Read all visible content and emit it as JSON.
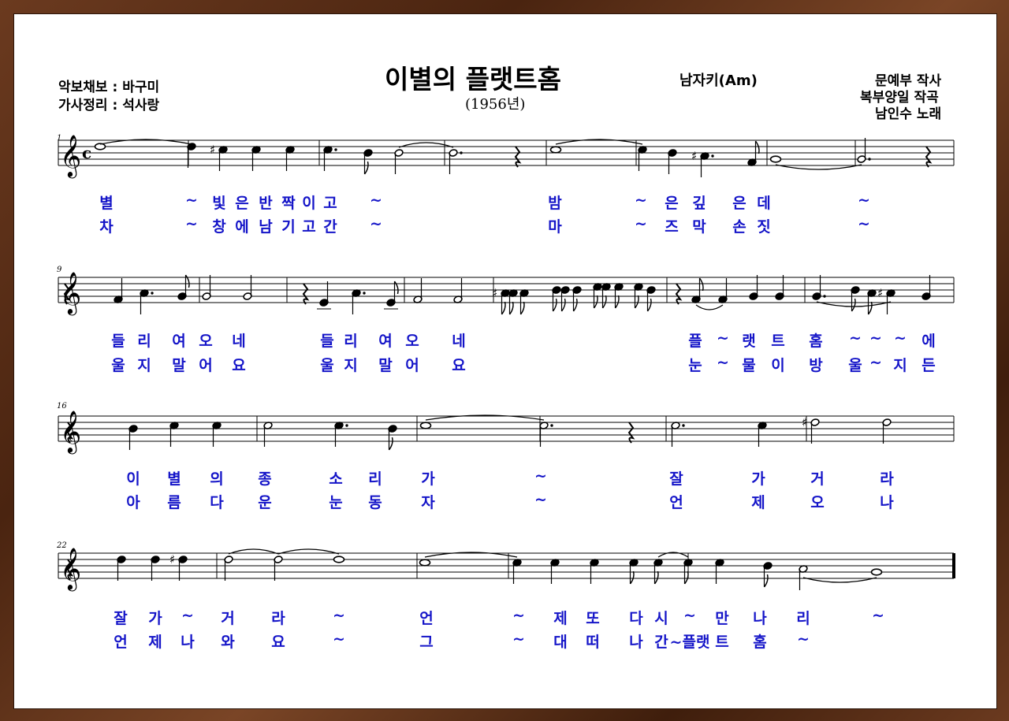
{
  "title": "이별의 플랫트홈",
  "year": "(1956년)",
  "key": "남자키(Am)",
  "credits_left": [
    "악보채보 : 바구미",
    "가사정리 : 석사랑"
  ],
  "credits_right": [
    "문예부 작사",
    "복부양일 작곡",
    "남인수 노래"
  ],
  "time_signature": "c",
  "systems": [
    {
      "measure_start": "1",
      "lyrics1": [
        "별",
        "~",
        "빛",
        "은",
        "반",
        "짝",
        "이",
        "고",
        "~",
        "밤",
        "~",
        "은",
        "깊",
        "은",
        "데",
        "~"
      ],
      "lyrics2": [
        "차",
        "~",
        "창",
        "에",
        "남",
        "기",
        "고",
        "간",
        "~",
        "마",
        "~",
        "즈",
        "막",
        "손",
        "짓",
        "~"
      ]
    },
    {
      "measure_start": "9",
      "lyrics1": [
        "들",
        "리",
        "여",
        "오",
        "네",
        "들",
        "리",
        "여",
        "오",
        "네",
        "플",
        "~",
        "랫",
        "트",
        "홈",
        "~",
        "~",
        "~",
        "에"
      ],
      "lyrics2": [
        "울",
        "지",
        "말",
        "어",
        "요",
        "울",
        "지",
        "말",
        "어",
        "요",
        "눈",
        "~",
        "물",
        "이",
        "방",
        "울",
        "~",
        "지",
        "든"
      ]
    },
    {
      "measure_start": "16",
      "lyrics1": [
        "이",
        "별",
        "의",
        "종",
        "소",
        "리",
        "가",
        "~",
        "잘",
        "가",
        "거",
        "라"
      ],
      "lyrics2": [
        "아",
        "름",
        "다",
        "운",
        "눈",
        "동",
        "자",
        "~",
        "언",
        "제",
        "오",
        "나"
      ]
    },
    {
      "measure_start": "22",
      "lyrics1": [
        "잘",
        "가",
        "~",
        "거",
        "라",
        "~",
        "언",
        "~",
        "제",
        "또",
        "다",
        "시",
        "~",
        "만",
        "나",
        "리",
        "~"
      ],
      "lyrics2": [
        "언",
        "제",
        "나",
        "와",
        "요",
        "~",
        "그",
        "~",
        "대",
        "떠",
        "나",
        "간",
        "~플랫",
        "트",
        "홈",
        "~"
      ]
    }
  ]
}
